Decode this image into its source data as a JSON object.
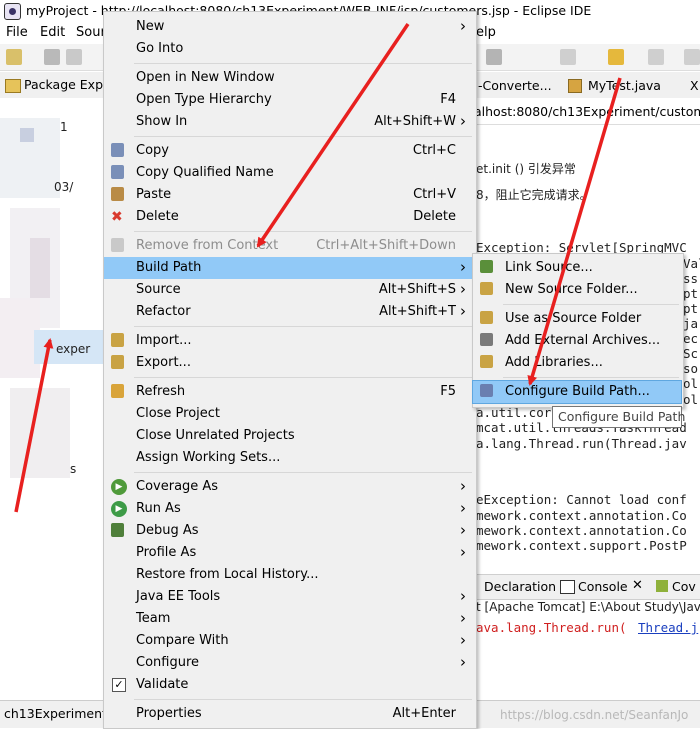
{
  "window": {
    "title": "myProject - http://localhost:8080/ch13Experiment/WEB-INF/jsp/customers.jsp - Eclipse IDE"
  },
  "menubar": [
    "File",
    "Edit",
    "Sour",
    "elp"
  ],
  "package_explorer": {
    "title": "Package Expl",
    "items": [
      "1",
      "03/",
      "exper",
      "s"
    ]
  },
  "editor": {
    "tabs": [
      "-Converte...",
      "MyTest.java",
      "X"
    ],
    "url": "alhost:8080/ch13Experiment/customDat",
    "console_lines": [
      "et.init () 引发异常",
      "8，阻止它完成请求。",
      "Exception: Servlet[SpringMVC",
      "a.util.cor",
      "mcat.util.threads.TaskThread",
      "a.lang.Thread.run(Thread.jav",
      "eException: Cannot load conf",
      "mework.context.annotation.Co",
      "mework.context.annotation.Co",
      "mework.context.support.PostP"
    ],
    "right_edge_fragments": [
      "Val",
      "ss",
      "pt",
      "pt",
      "ja",
      "ec",
      "Sc",
      "so",
      "ol",
      "ol"
    ],
    "bottom_tabs": [
      "Declaration",
      "Console",
      "Cov"
    ],
    "console_header": "t [Apache Tomcat] E:\\About Study\\Jav",
    "stack_line": "ava.lang.Thread.run(",
    "stack_link": "Thread.j"
  },
  "status": {
    "project": "ch13Experiment",
    "watermark": "https://blog.csdn.net/SeanfanJo"
  },
  "context_menu": {
    "items": [
      {
        "label": "New",
        "shortcut": "",
        "submenu": true,
        "icon": "",
        "disabled": false
      },
      {
        "label": "Go Into",
        "shortcut": "",
        "submenu": false,
        "icon": "",
        "disabled": false
      },
      {
        "sep": true
      },
      {
        "label": "Open in New Window",
        "shortcut": "",
        "submenu": false,
        "icon": "",
        "disabled": false
      },
      {
        "label": "Open Type Hierarchy",
        "shortcut": "F4",
        "submenu": false,
        "icon": "",
        "disabled": false
      },
      {
        "label": "Show In",
        "shortcut": "Alt+Shift+W",
        "submenu": true,
        "icon": "",
        "disabled": false
      },
      {
        "sep": true
      },
      {
        "label": "Copy",
        "shortcut": "Ctrl+C",
        "submenu": false,
        "icon": "copy-icon",
        "disabled": false
      },
      {
        "label": "Copy Qualified Name",
        "shortcut": "",
        "submenu": false,
        "icon": "copy-qualified-icon",
        "disabled": false
      },
      {
        "label": "Paste",
        "shortcut": "Ctrl+V",
        "submenu": false,
        "icon": "paste-icon",
        "disabled": false
      },
      {
        "label": "Delete",
        "shortcut": "Delete",
        "submenu": false,
        "icon": "delete-icon",
        "disabled": false
      },
      {
        "sep": true
      },
      {
        "label": "Remove from Context",
        "shortcut": "Ctrl+Alt+Shift+Down",
        "submenu": false,
        "icon": "remove-context-icon",
        "disabled": true
      },
      {
        "label": "Build Path",
        "shortcut": "",
        "submenu": true,
        "icon": "",
        "disabled": false,
        "highlighted": true
      },
      {
        "label": "Source",
        "shortcut": "Alt+Shift+S",
        "submenu": true,
        "icon": "",
        "disabled": false
      },
      {
        "label": "Refactor",
        "shortcut": "Alt+Shift+T",
        "submenu": true,
        "icon": "",
        "disabled": false
      },
      {
        "sep": true
      },
      {
        "label": "Import...",
        "shortcut": "",
        "submenu": false,
        "icon": "import-icon",
        "disabled": false
      },
      {
        "label": "Export...",
        "shortcut": "",
        "submenu": false,
        "icon": "export-icon",
        "disabled": false
      },
      {
        "sep": true
      },
      {
        "label": "Refresh",
        "shortcut": "F5",
        "submenu": false,
        "icon": "refresh-icon",
        "disabled": false
      },
      {
        "label": "Close Project",
        "shortcut": "",
        "submenu": false,
        "icon": "",
        "disabled": false
      },
      {
        "label": "Close Unrelated Projects",
        "shortcut": "",
        "submenu": false,
        "icon": "",
        "disabled": false
      },
      {
        "label": "Assign Working Sets...",
        "shortcut": "",
        "submenu": false,
        "icon": "",
        "disabled": false
      },
      {
        "sep": true
      },
      {
        "label": "Coverage As",
        "shortcut": "",
        "submenu": true,
        "icon": "coverage-icon",
        "disabled": false
      },
      {
        "label": "Run As",
        "shortcut": "",
        "submenu": true,
        "icon": "run-icon",
        "disabled": false
      },
      {
        "label": "Debug As",
        "shortcut": "",
        "submenu": true,
        "icon": "debug-icon",
        "disabled": false
      },
      {
        "label": "Profile As",
        "shortcut": "",
        "submenu": true,
        "icon": "",
        "disabled": false
      },
      {
        "label": "Restore from Local History...",
        "shortcut": "",
        "submenu": false,
        "icon": "",
        "disabled": false
      },
      {
        "label": "Java EE Tools",
        "shortcut": "",
        "submenu": true,
        "icon": "",
        "disabled": false
      },
      {
        "label": "Team",
        "shortcut": "",
        "submenu": true,
        "icon": "",
        "disabled": false
      },
      {
        "label": "Compare With",
        "shortcut": "",
        "submenu": true,
        "icon": "",
        "disabled": false
      },
      {
        "label": "Configure",
        "shortcut": "",
        "submenu": true,
        "icon": "",
        "disabled": false
      },
      {
        "label": "Validate",
        "shortcut": "",
        "submenu": false,
        "icon": "validate-check-icon",
        "disabled": false
      },
      {
        "sep": true
      },
      {
        "label": "Properties",
        "shortcut": "Alt+Enter",
        "submenu": false,
        "icon": "",
        "disabled": false
      }
    ]
  },
  "build_path_submenu": {
    "items": [
      {
        "label": "Link Source...",
        "icon": "link-source-icon"
      },
      {
        "label": "New Source Folder...",
        "icon": "new-source-folder-icon"
      },
      {
        "sep": true
      },
      {
        "label": "Use as Source Folder",
        "icon": "use-source-folder-icon"
      },
      {
        "label": "Add External Archives...",
        "icon": "external-archive-icon"
      },
      {
        "label": "Add Libraries...",
        "icon": "add-library-icon"
      },
      {
        "sep": true
      },
      {
        "label": "Configure Build Path...",
        "icon": "configure-build-path-icon",
        "highlighted": true
      }
    ]
  },
  "tooltip": "Configure Build Path",
  "colors": {
    "highlight": "#91c9f7",
    "arrow": "#e8201f",
    "menu_bg": "#f0f0f0"
  }
}
